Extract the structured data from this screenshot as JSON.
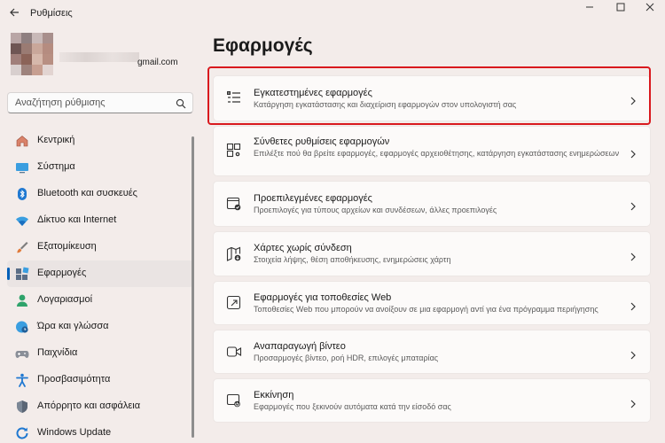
{
  "window": {
    "title": "Ρυθμίσεις",
    "back_icon": "back-arrow-icon",
    "controls": [
      "minimize-icon",
      "maximize-icon",
      "close-icon"
    ]
  },
  "profile": {
    "email": "gmail.com"
  },
  "search": {
    "placeholder": "Αναζήτηση ρύθμισης"
  },
  "sidebar": {
    "items": [
      {
        "label": "Κεντρική",
        "icon": "home-icon"
      },
      {
        "label": "Σύστημα",
        "icon": "system-icon"
      },
      {
        "label": "Bluetooth και συσκευές",
        "icon": "bluetooth-icon"
      },
      {
        "label": "Δίκτυο και Internet",
        "icon": "wifi-icon"
      },
      {
        "label": "Εξατομίκευση",
        "icon": "brush-icon"
      },
      {
        "label": "Εφαρμογές",
        "icon": "apps-icon",
        "active": true
      },
      {
        "label": "Λογαριασμοί",
        "icon": "account-icon"
      },
      {
        "label": "Ώρα και γλώσσα",
        "icon": "globe-clock-icon"
      },
      {
        "label": "Παιχνίδια",
        "icon": "gamepad-icon"
      },
      {
        "label": "Προσβασιμότητα",
        "icon": "accessibility-icon"
      },
      {
        "label": "Απόρρητο και ασφάλεια",
        "icon": "shield-icon"
      },
      {
        "label": "Windows Update",
        "icon": "update-icon"
      }
    ]
  },
  "main": {
    "title": "Εφαρμογές",
    "cards": [
      {
        "title": "Εγκατεστημένες εφαρμογές",
        "desc": "Κατάργηση εγκατάστασης και διαχείριση εφαρμογών στον υπολογιστή σας",
        "icon": "installed-apps-icon",
        "highlighted": true
      },
      {
        "title": "Σύνθετες ρυθμίσεις εφαρμογών",
        "desc": "Επιλέξτε πού θα βρείτε εφαρμογές, εφαρμογές αρχειοθέτησης, κατάργηση εγκατάστασης ενημερώσεων",
        "icon": "advanced-apps-icon"
      },
      {
        "title": "Προεπιλεγμένες εφαρμογές",
        "desc": "Προεπιλογές για τύπους αρχείων και συνδέσεων, άλλες προεπιλογές",
        "icon": "default-apps-icon"
      },
      {
        "title": "Χάρτες χωρίς σύνδεση",
        "desc": "Στοιχεία λήψης, θέση αποθήκευσης, ενημερώσεις χάρτη",
        "icon": "offline-maps-icon"
      },
      {
        "title": "Εφαρμογές για τοποθεσίες Web",
        "desc": "Τοποθεσίες Web που μπορούν να ανοίξουν σε μια εφαρμογή αντί για ένα πρόγραμμα περιήγησης",
        "icon": "web-apps-icon"
      },
      {
        "title": "Αναπαραγωγή βίντεο",
        "desc": "Προσαρμογές βίντεο, ροή HDR, επιλογές μπαταρίας",
        "icon": "video-icon"
      },
      {
        "title": "Εκκίνηση",
        "desc": "Εφαρμογές που ξεκινούν αυτόματα κατά την είσοδό σας",
        "icon": "startup-icon"
      }
    ]
  },
  "colors": {
    "accent": "#005fb8",
    "highlight_border": "#d9191e",
    "background": "#f3ecea"
  }
}
